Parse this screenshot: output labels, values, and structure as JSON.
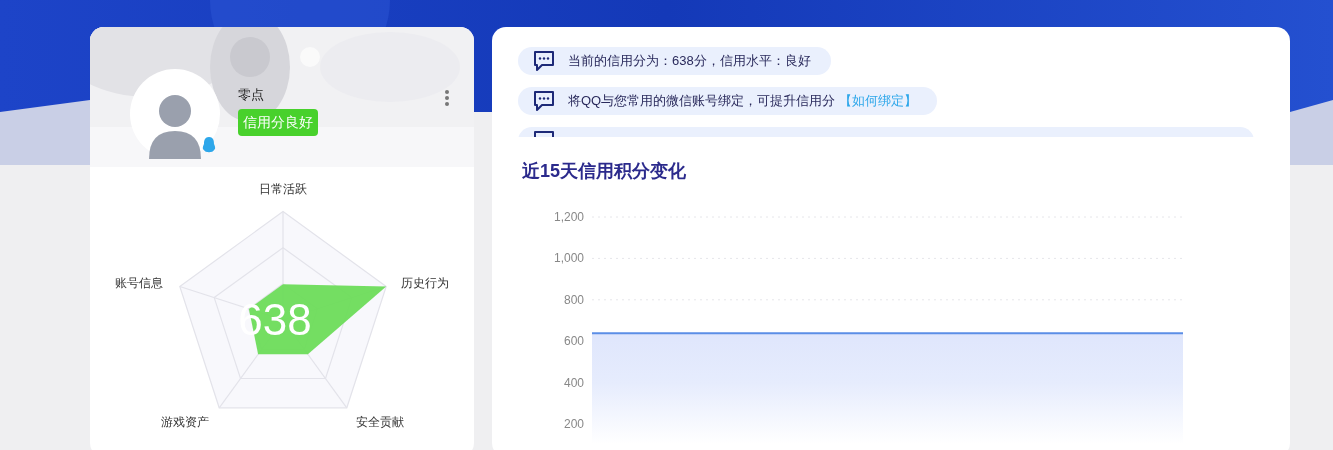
{
  "profile": {
    "name": "零点",
    "badge": "信用分良好"
  },
  "radar": {
    "score": "638",
    "axes": [
      "日常活跃",
      "历史行为",
      "安全贡献",
      "游戏资产",
      "账号信息"
    ]
  },
  "notices": [
    {
      "kind": "notice",
      "text": "当前的信用分为：638分，信用水平：良好"
    },
    {
      "kind": "notice",
      "text": "将QQ与您常用的微信账号绑定，可提升信用分",
      "link": "【如何绑定】"
    },
    {
      "kind": "notice"
    }
  ],
  "trend": {
    "title": "近15天信用积分变化",
    "chart_data": {
      "type": "area",
      "ylim": [
        200,
        1200
      ],
      "yticks": [
        {
          "value": 200,
          "label": "200"
        },
        {
          "value": 400,
          "label": "400"
        },
        {
          "value": 600,
          "label": "600"
        },
        {
          "value": 800,
          "label": "800"
        },
        {
          "value": 1000,
          "label": "1,000"
        },
        {
          "value": 1200,
          "label": "1,200"
        }
      ],
      "series": [
        {
          "color": "#5b8ee6",
          "values": [
            638,
            638,
            638,
            638,
            638,
            638,
            638,
            638,
            638,
            638,
            638,
            638,
            638,
            638,
            638
          ]
        }
      ]
    }
  }
}
